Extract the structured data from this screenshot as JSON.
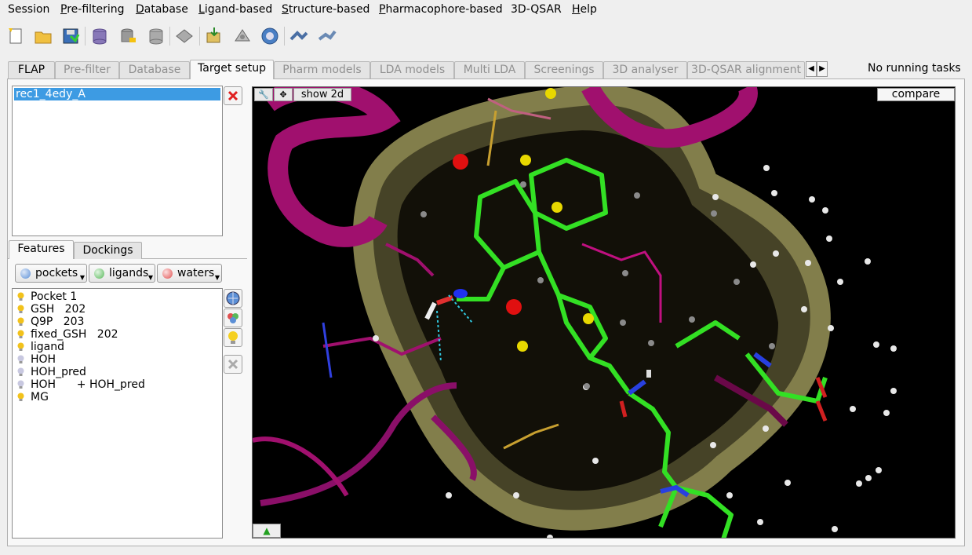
{
  "menu": [
    {
      "label": "Session",
      "underline": ""
    },
    {
      "label": "Pre-filtering",
      "underline": "P"
    },
    {
      "label": "Database",
      "underline": "D"
    },
    {
      "label": "Ligand-based",
      "underline": "L"
    },
    {
      "label": "Structure-based",
      "underline": "S"
    },
    {
      "label": "Pharmacophore-based",
      "underline": "P"
    },
    {
      "label": "3D-QSAR",
      "underline": ""
    },
    {
      "label": "Help",
      "underline": "H"
    }
  ],
  "toolbar": {
    "icons": [
      "new-session-icon",
      "open-folder-icon",
      "save-icon",
      "database-icon",
      "database-edit-icon",
      "database-export-icon",
      "pharmacophore-icon",
      "import-icon",
      "molecule-shape-icon",
      "gauge-icon",
      "align-icon",
      "transfer-icon"
    ]
  },
  "tabs": [
    "FLAP",
    "Pre-filter",
    "Database",
    "Target setup",
    "Pharm models",
    "LDA models",
    "Multi LDA",
    "Screenings",
    "3D analyser",
    "3D-QSAR alignment"
  ],
  "active_tab": "Target setup",
  "status": {
    "text": "No running tasks"
  },
  "receptors": [
    {
      "label": "rec1_4edy_A",
      "selected": true
    }
  ],
  "subtabs": [
    "Features",
    "Dockings"
  ],
  "filters": [
    {
      "label": "pockets",
      "color": "#5b8fd6"
    },
    {
      "label": "ligands",
      "color": "#58b85a"
    },
    {
      "label": "waters",
      "color": "#e05050"
    }
  ],
  "features": [
    {
      "label": "Pocket 1",
      "bulb": "#f2c21b"
    },
    {
      "label": "GSH   202",
      "bulb": "#f2c21b"
    },
    {
      "label": "Q9P   203",
      "bulb": "#f2c21b"
    },
    {
      "label": "fixed_GSH   202",
      "bulb": "#f2c21b"
    },
    {
      "label": "ligand",
      "bulb": "#f2c21b"
    },
    {
      "label": "HOH",
      "bulb": "#b8b8d8"
    },
    {
      "label": "HOH_pred",
      "bulb": "#b8b8d8"
    },
    {
      "label": "HOH      + HOH_pred",
      "bulb": "#b8b8d8"
    },
    {
      "label": "MG",
      "bulb": "#f2c21b"
    }
  ],
  "viewer": {
    "show2d_label": "show 2d",
    "compare_label": "compare",
    "colors": {
      "protein": "#a0106e",
      "ligand": "#33e024",
      "surface": "#8a8550",
      "background": "#000000"
    }
  }
}
